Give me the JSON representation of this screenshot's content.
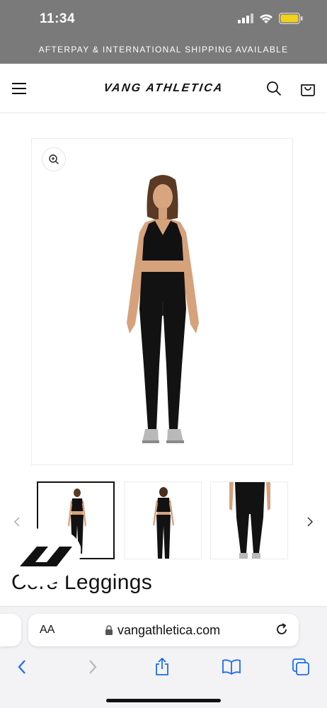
{
  "status": {
    "time": "11:34"
  },
  "announcement": "AFTERPAY & INTERNATIONAL SHIPPING AVAILABLE",
  "header": {
    "logo": "VANG ATHLETICA"
  },
  "product": {
    "title": "Core Leggings"
  },
  "browser": {
    "text_size_label": "AA",
    "url": "vangathletica.com"
  },
  "colors": {
    "topbar": "#7a7a7a",
    "accent": "#1a6cf0",
    "battery": "#f2d21a"
  },
  "icons": [
    "menu-icon",
    "search-icon",
    "bag-icon",
    "zoom-icon",
    "chevron-left-icon",
    "chevron-right-icon",
    "lock-icon",
    "reload-icon",
    "back-icon",
    "forward-icon",
    "share-icon",
    "bookmarks-icon",
    "tabs-icon"
  ]
}
